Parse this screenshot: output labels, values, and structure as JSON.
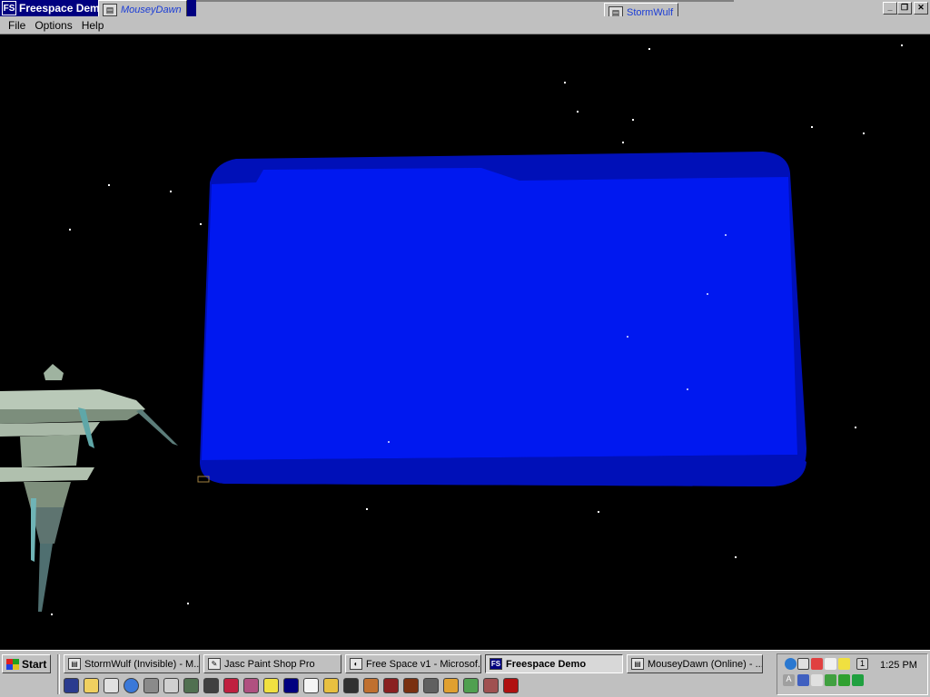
{
  "window": {
    "app_icon_text": "FS",
    "title": "Freespace Demo",
    "floating_tags": [
      {
        "label": "MouseyDawn"
      },
      {
        "label": "StormWulf"
      }
    ]
  },
  "menu": [
    {
      "label": "File"
    },
    {
      "label": "Options"
    },
    {
      "label": "Help"
    }
  ],
  "taskbar": {
    "start_label": "Start",
    "tasks": [
      {
        "label": "StormWulf (Invisible) - M...",
        "icon": "messenger-icon",
        "active": false
      },
      {
        "label": "Jasc Paint Shop Pro",
        "icon": "paintbrush-icon",
        "active": false
      },
      {
        "label": "Free Space v1 - Microsof...",
        "icon": "paint-palette-icon",
        "active": false
      },
      {
        "label": "Freespace Demo",
        "icon": "fs-icon",
        "active": true
      },
      {
        "label": "MouseyDawn (Online) - ...",
        "icon": "messenger-icon",
        "active": false
      }
    ],
    "clock": "1:25 PM",
    "tray_badge": "1"
  },
  "colors": {
    "title_active": "#000080",
    "panel_blue": "#0018f0",
    "panel_dark": "#0010b0",
    "chrome": "#c0c0c0"
  }
}
